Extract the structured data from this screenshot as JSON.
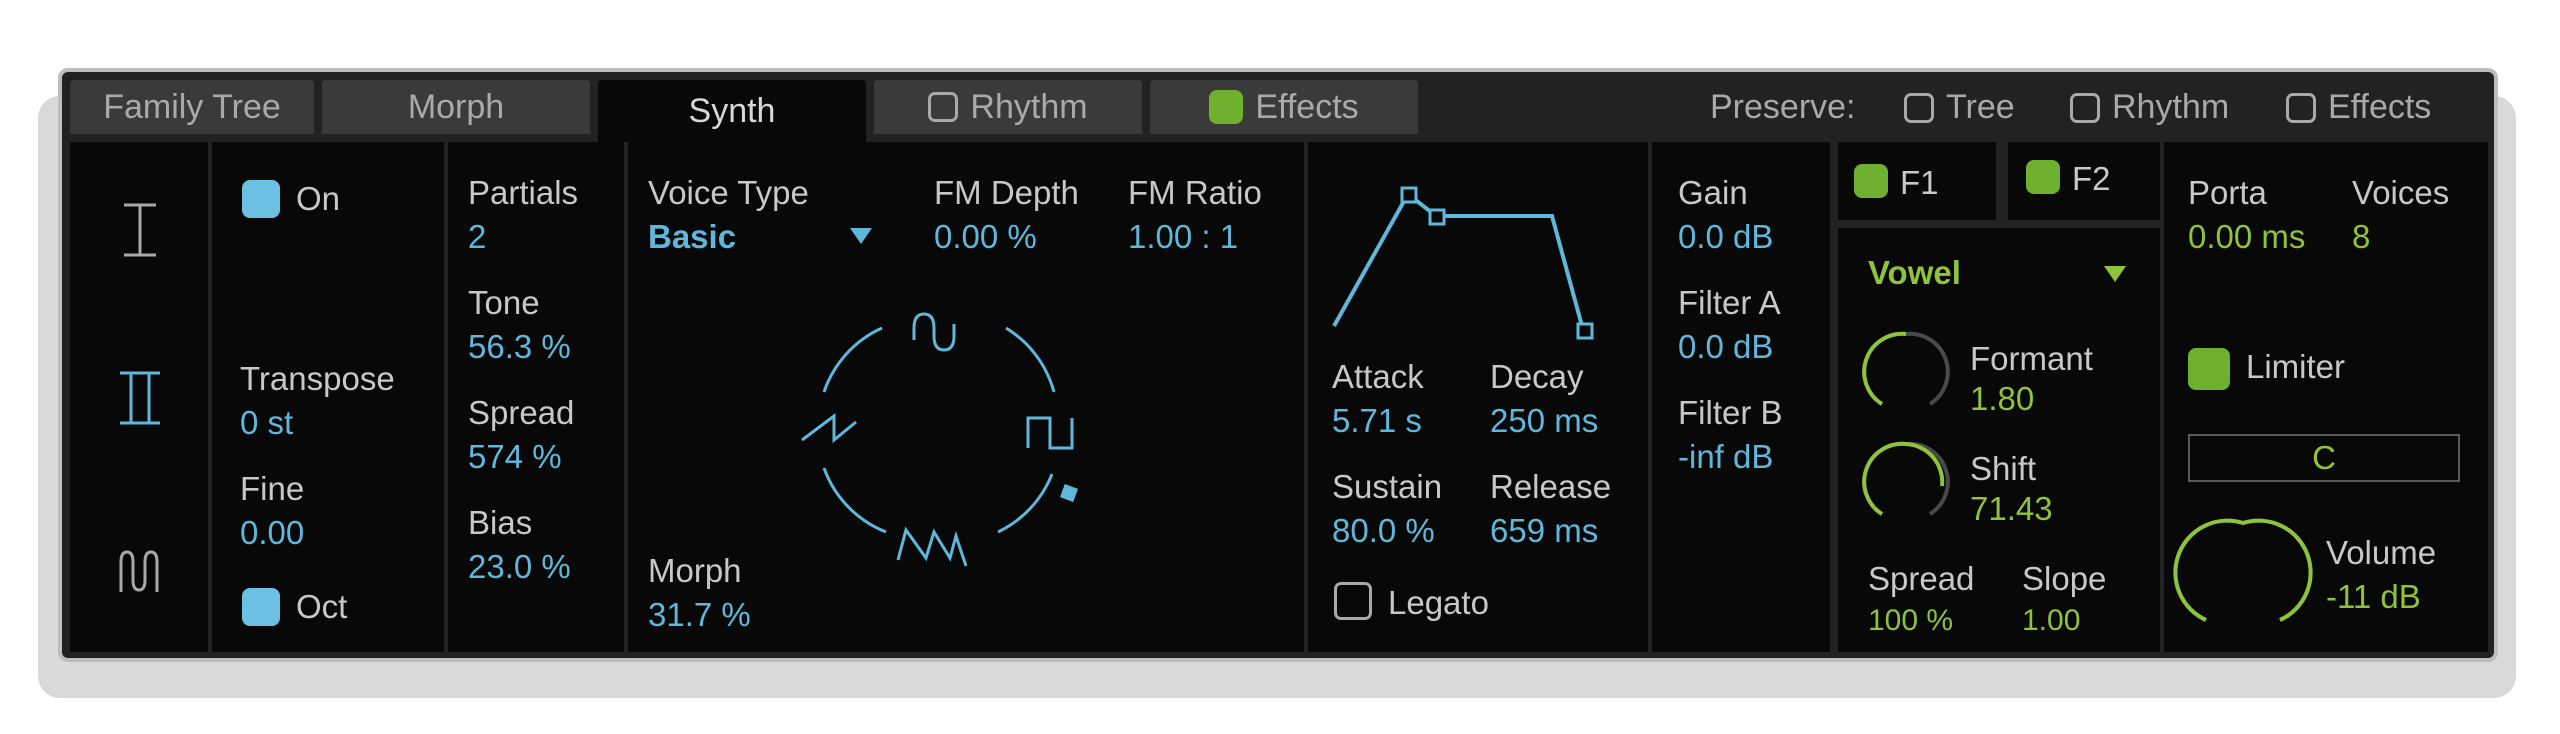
{
  "tabs": {
    "family_tree": "Family Tree",
    "morph": "Morph",
    "synth": "Synth",
    "rhythm": "Rhythm",
    "effects": "Effects"
  },
  "preserve": {
    "label": "Preserve:",
    "tree": "Tree",
    "rhythm": "Rhythm",
    "effects": "Effects"
  },
  "oscillator": {
    "on_label": "On",
    "transpose_label": "Transpose",
    "transpose_value": "0 st",
    "fine_label": "Fine",
    "fine_value": "0.00",
    "oct_label": "Oct"
  },
  "harmonics": {
    "partials_label": "Partials",
    "partials_value": "2",
    "tone_label": "Tone",
    "tone_value": "56.3 %",
    "spread_label": "Spread",
    "spread_value": "574 %",
    "bias_label": "Bias",
    "bias_value": "23.0 %"
  },
  "voice": {
    "voice_type_label": "Voice Type",
    "voice_type_value": "Basic",
    "fm_depth_label": "FM Depth",
    "fm_depth_value": "0.00 %",
    "fm_ratio_label": "FM Ratio",
    "fm_ratio_value": "1.00 : 1",
    "morph_label": "Morph",
    "morph_value": "31.7 %"
  },
  "envelope": {
    "attack_label": "Attack",
    "attack_value": "5.71 s",
    "decay_label": "Decay",
    "decay_value": "250 ms",
    "sustain_label": "Sustain",
    "sustain_value": "80.0 %",
    "release_label": "Release",
    "release_value": "659 ms",
    "legato_label": "Legato"
  },
  "mixer": {
    "gain_label": "Gain",
    "gain_value": "0.0 dB",
    "filter_a_label": "Filter A",
    "filter_a_value": "0.0 dB",
    "filter_b_label": "Filter B",
    "filter_b_value": "-inf dB"
  },
  "filter": {
    "f1_label": "F1",
    "f2_label": "F2",
    "type_value": "Vowel",
    "formant_label": "Formant",
    "formant_value": "1.80",
    "shift_label": "Shift",
    "shift_value": "71.43",
    "spread_label": "Spread",
    "spread_value": "100 %",
    "slope_label": "Slope",
    "slope_value": "1.00"
  },
  "global": {
    "porta_label": "Porta",
    "porta_value": "0.00 ms",
    "voices_label": "Voices",
    "voices_value": "8",
    "limiter_label": "Limiter",
    "key_value": "C",
    "volume_label": "Volume",
    "volume_value": "-11 dB"
  },
  "colors": {
    "blue_accent": "#5fb8dc",
    "green_accent": "#8fc33a",
    "panel_bg": "#080808",
    "frame_bg": "#222222"
  }
}
